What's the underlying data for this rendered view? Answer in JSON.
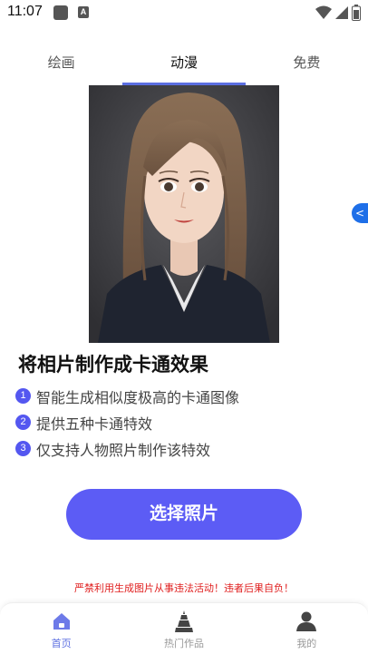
{
  "status_bar": {
    "time": "11:07",
    "a_glyph": "A"
  },
  "tabs": [
    {
      "label": "绘画",
      "active": false
    },
    {
      "label": "动漫",
      "active": true
    },
    {
      "label": "免费",
      "active": false
    }
  ],
  "side_tab": {
    "glyph": "<"
  },
  "headline": "将相片制作成卡通效果",
  "features": [
    {
      "num": "1",
      "text": "智能生成相似度极高的卡通图像"
    },
    {
      "num": "2",
      "text": "提供五种卡通特效"
    },
    {
      "num": "3",
      "text": "仅支持人物照片制作该特效"
    }
  ],
  "choose_button": "选择照片",
  "warning": "严禁利用生成图片从事违法活动！违者后果自负！",
  "bottom_nav": [
    {
      "label": "首页",
      "icon": "home-icon",
      "active": true
    },
    {
      "label": "热门作品",
      "icon": "tower-icon",
      "active": false
    },
    {
      "label": "我的",
      "icon": "person-icon",
      "active": false
    }
  ],
  "colors": {
    "accent": "#5c5cf5",
    "tab_indicator": "#5b6ee1",
    "warning": "#e02020",
    "side_tab": "#1e6fe8"
  }
}
